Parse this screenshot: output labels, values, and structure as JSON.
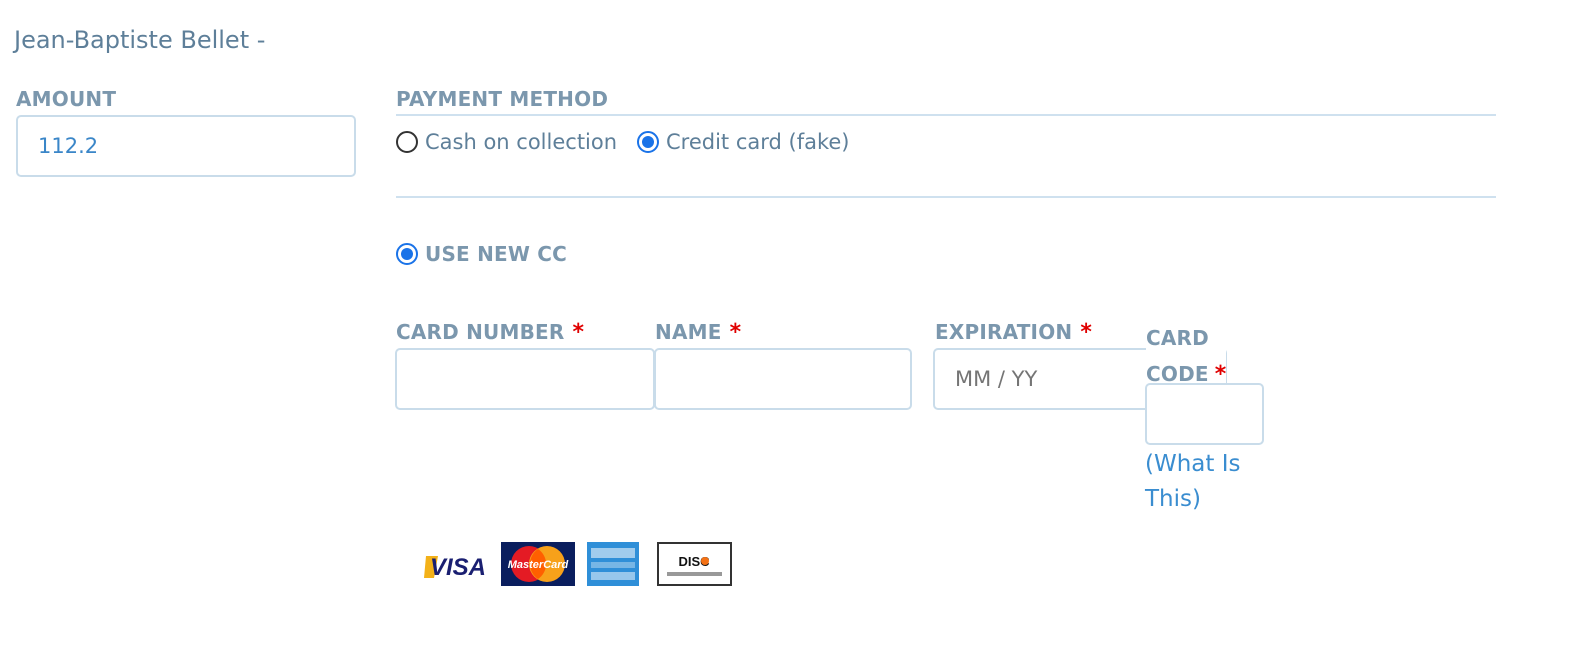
{
  "customer": {
    "name": "Jean-Baptiste Bellet -"
  },
  "amount": {
    "label": "AMOUNT",
    "value": "112.2"
  },
  "payment_method": {
    "label": "PAYMENT METHOD",
    "options": [
      {
        "label": "Cash on collection",
        "selected": false
      },
      {
        "label": "Credit card (fake)",
        "selected": true
      }
    ]
  },
  "credit_card": {
    "use_new_label": "USE NEW CC",
    "use_new_selected": true,
    "card_number_label": "CARD NUMBER",
    "name_label": "NAME",
    "expiration_label": "EXPIRATION",
    "expiration_placeholder": "MM / YY",
    "card_code_label_line1": "CARD",
    "card_code_label_line2": "CODE",
    "required_mark": "*",
    "what_is_this_line1": "(What Is",
    "what_is_this_line2": "This)"
  },
  "card_logos": [
    {
      "name": "VISA",
      "icon": "visa-logo-icon"
    },
    {
      "name": "MasterCard",
      "icon": "mastercard-logo-icon"
    },
    {
      "name": "American Express",
      "icon": "amex-logo-icon"
    },
    {
      "name": "DISCOVER",
      "icon": "discover-logo-icon"
    }
  ],
  "colors": {
    "label": "#7b97ad",
    "text": "#5e7f99",
    "link": "#3a8dd0",
    "required": "#e00000",
    "radio_selected": "#1a73e8",
    "border": "#c9dcea"
  }
}
